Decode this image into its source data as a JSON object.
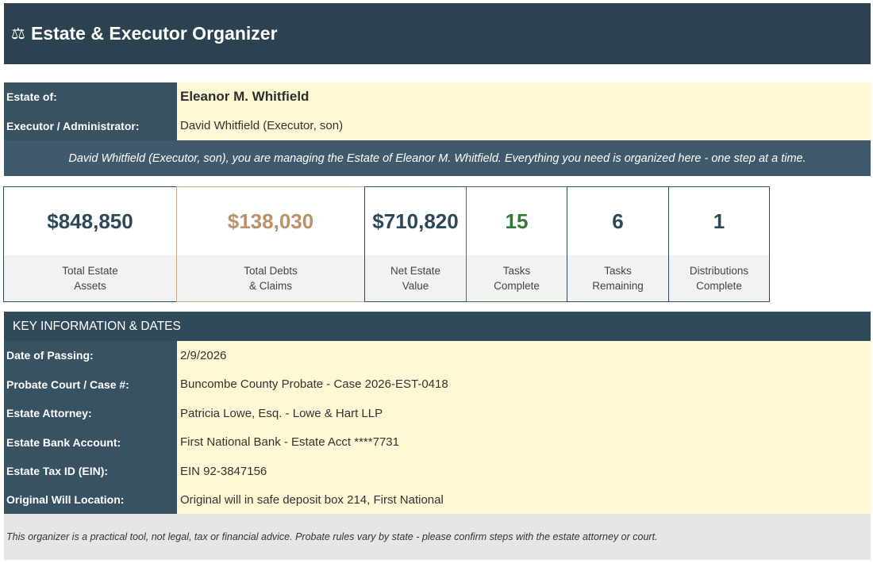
{
  "header": {
    "icon": "⚖",
    "title": "Estate & Executor Organizer"
  },
  "estate": {
    "estate_of_label": "Estate of:",
    "estate_of_value": "Eleanor M. Whitfield",
    "executor_label": "Executor / Administrator:",
    "executor_value": "David Whitfield (Executor, son)",
    "welcome": "David Whitfield (Executor, son), you are managing the Estate of Eleanor M. Whitfield. Everything you need is organized here - one step at a time."
  },
  "kpis": [
    {
      "value": "$848,850",
      "caption": "Total Estate\nAssets",
      "color": "#2d4858"
    },
    {
      "value": "$138,030",
      "caption": "Total Debts\n& Claims",
      "color": "#b8926a"
    },
    {
      "value": "$710,820",
      "caption": "Net Estate\nValue",
      "color": "#2d4858"
    },
    {
      "value": "15",
      "caption": "Tasks\nComplete",
      "color": "#2e7d32"
    },
    {
      "value": "6",
      "caption": "Tasks\nRemaining",
      "color": "#2d4858"
    },
    {
      "value": "1",
      "caption": "Distributions\nComplete",
      "color": "#2d4858"
    }
  ],
  "key_info": {
    "section_title": "KEY INFORMATION & DATES",
    "rows": [
      {
        "label": "Date of Passing:",
        "value": "2/9/2026"
      },
      {
        "label": "Probate Court / Case #:",
        "value": "Buncombe County Probate - Case 2026-EST-0418"
      },
      {
        "label": "Estate Attorney:",
        "value": "Patricia Lowe, Esq. - Lowe & Hart LLP"
      },
      {
        "label": "Estate Bank Account:",
        "value": "First National Bank - Estate Acct ****7731"
      },
      {
        "label": "Estate Tax ID (EIN):",
        "value": "EIN 92-3847156"
      },
      {
        "label": "Original Will Location:",
        "value": "Original will in safe deposit box 214, First National"
      }
    ]
  },
  "footer": "This organizer is a practical tool, not legal, tax or financial advice. Probate rules vary by state - please confirm steps with the estate attorney or court."
}
